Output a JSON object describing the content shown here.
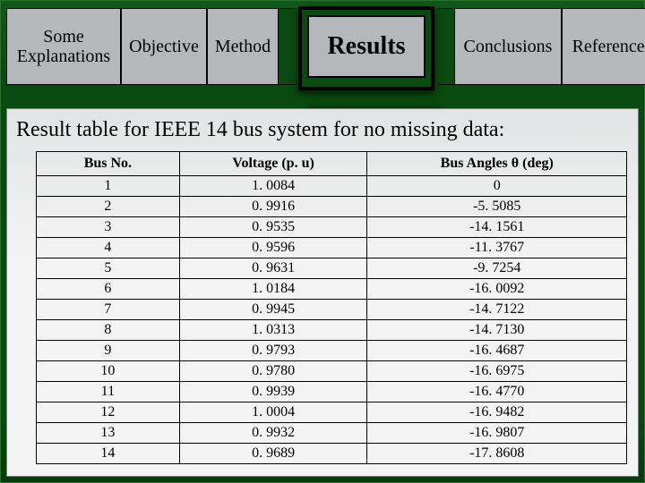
{
  "tabs": {
    "items": [
      {
        "label": "Some\nExplanations"
      },
      {
        "label": "Objective"
      },
      {
        "label": "Method"
      },
      {
        "label": "Results"
      },
      {
        "label": "Conclusions"
      },
      {
        "label": "References"
      }
    ],
    "active_index": 3
  },
  "content": {
    "title": "Result table for IEEE 14 bus system for no missing data:"
  },
  "chart_data": {
    "type": "table",
    "columns": [
      "Bus No.",
      "Voltage (p. u)",
      "Bus Angles θ (deg)"
    ],
    "rows": [
      [
        "1",
        "1. 0084",
        "0"
      ],
      [
        "2",
        "0. 9916",
        "-5. 5085"
      ],
      [
        "3",
        "0. 9535",
        "-14. 1561"
      ],
      [
        "4",
        "0. 9596",
        "-11. 3767"
      ],
      [
        "5",
        "0. 9631",
        "-9. 7254"
      ],
      [
        "6",
        "1. 0184",
        "-16. 0092"
      ],
      [
        "7",
        "0. 9945",
        "-14. 7122"
      ],
      [
        "8",
        "1. 0313",
        "-14. 7130"
      ],
      [
        "9",
        "0. 9793",
        "-16. 4687"
      ],
      [
        "10",
        "0. 9780",
        "-16. 6975"
      ],
      [
        "11",
        "0. 9939",
        "-16. 4770"
      ],
      [
        "12",
        "1. 0004",
        "-16. 9482"
      ],
      [
        "13",
        "0. 9932",
        "-16. 9807"
      ],
      [
        "14",
        "0. 9689",
        "-17. 8608"
      ]
    ]
  }
}
